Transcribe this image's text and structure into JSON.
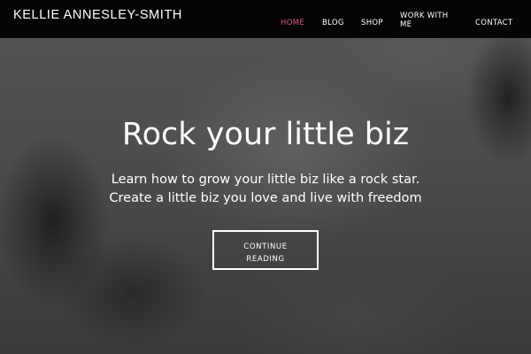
{
  "site": {
    "logo": "KELLIE ANNESLEY-SMITH"
  },
  "nav": {
    "items": [
      {
        "label": "HOME",
        "active": true
      },
      {
        "label": "BLOG",
        "active": false
      },
      {
        "label": "SHOP",
        "active": false
      },
      {
        "label": "WORK WITH ME",
        "active": false
      },
      {
        "label": "CONTACT",
        "active": false
      }
    ],
    "active_color": "#d4588b"
  },
  "hero": {
    "title": "Rock your little biz",
    "line_1": "Learn how to grow your little biz like a rock star.",
    "line_2": "Create a little biz you love and live with freedom",
    "cta_label": "CONTINUE READING"
  },
  "colors": {
    "header_bg": "#050505",
    "text": "#ffffff"
  }
}
